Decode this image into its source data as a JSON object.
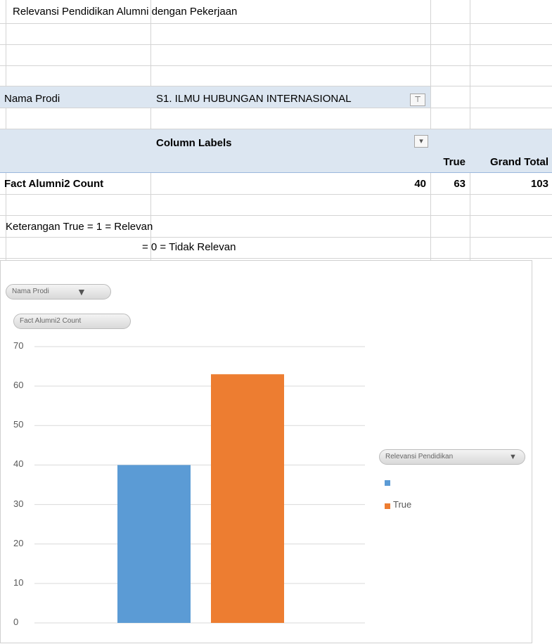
{
  "sheet": {
    "title": "Relevansi Pendidikan Alumni dengan Pekerjaan",
    "filter_label": "Nama Prodi",
    "filter_value": "S1. ILMU HUBUNGAN INTERNASIONAL",
    "column_labels": "Column Labels",
    "col_true": "True",
    "col_grand_total": "Grand Total",
    "row_label": "Fact Alumni2 Count",
    "values": [
      "40",
      "63",
      "103"
    ],
    "note_line1": "Keterangan True =  1 = Relevan",
    "note_line2": "= 0 = Tidak Relevan"
  },
  "chart": {
    "filter_pill": "Nama Prodi",
    "value_pill": "Fact Alumni2 Count",
    "legend_pill": "Relevansi Pendidikan",
    "legend_items": [
      "",
      "True"
    ]
  },
  "colors": {
    "series_blank": "#5b9bd5",
    "series_true": "#ed7d31",
    "header_band": "#dce6f1"
  },
  "chart_data": {
    "type": "bar",
    "categories": [
      "",
      "True"
    ],
    "values": [
      40,
      63
    ],
    "ylim": [
      0,
      70
    ],
    "yticks": [
      0,
      10,
      20,
      30,
      40,
      50,
      60,
      70
    ],
    "legend_title": "Relevansi Pendidikan",
    "legend_position": "right",
    "grid": true
  }
}
